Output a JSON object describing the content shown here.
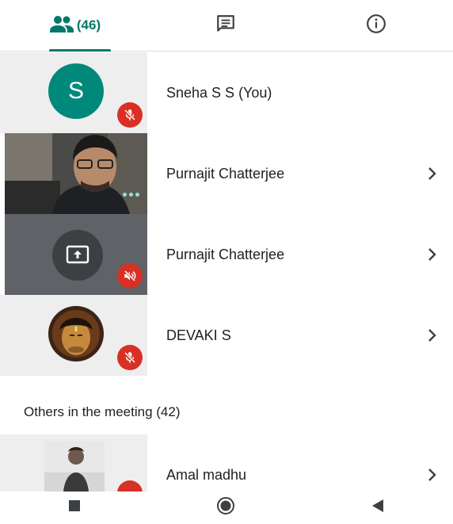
{
  "tabs": [
    {
      "icon": "people-icon",
      "count": "(46)",
      "active": true
    },
    {
      "icon": "chat-icon",
      "active": false
    },
    {
      "icon": "info-icon",
      "active": false
    }
  ],
  "participants": [
    {
      "name": "Sneha S S (You)",
      "initial": "S",
      "muted": true
    },
    {
      "name": "Purnajit Chatterjee",
      "muted": false
    },
    {
      "name": "Purnajit Chatterjee",
      "presenting": true,
      "muted": true
    },
    {
      "name": "DEVAKI S",
      "muted": true
    }
  ],
  "others": {
    "header": "Others in the meeting (42)",
    "items": [
      {
        "name": "Amal madhu"
      }
    ]
  },
  "nav": [
    "recents-icon",
    "home-icon",
    "back-icon"
  ],
  "colors": {
    "accent": "#00796b",
    "avatar": "#00897b",
    "mute": "#d93025"
  }
}
